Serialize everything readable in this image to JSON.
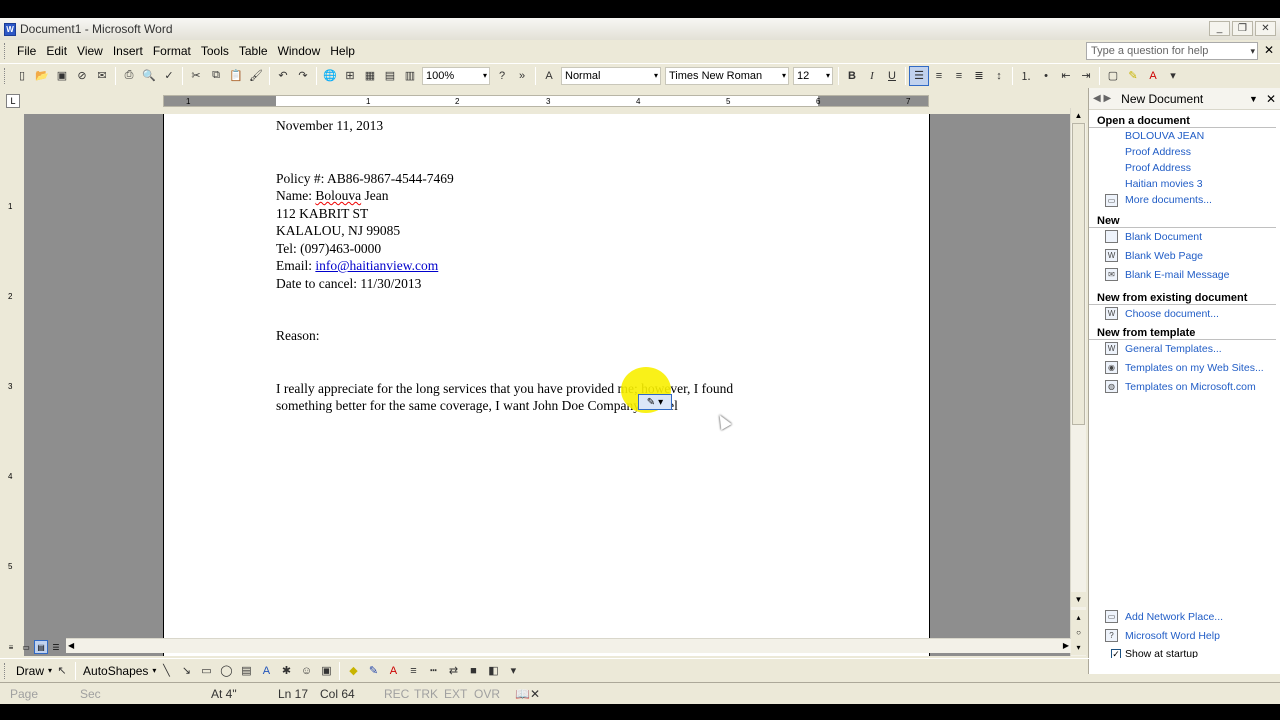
{
  "window": {
    "title": "Document1 - Microsoft Word",
    "app_icon": "W"
  },
  "menu": {
    "items": [
      "File",
      "Edit",
      "View",
      "Insert",
      "Format",
      "Tools",
      "Table",
      "Window",
      "Help"
    ],
    "help_placeholder": "Type a question for help"
  },
  "toolbar": {
    "zoom": "100%",
    "style": "Normal",
    "font": "Times New Roman",
    "size": "12",
    "bold": "B",
    "italic": "I",
    "underline": "U"
  },
  "ruler": {
    "numbers": [
      "1",
      "1",
      "2",
      "3",
      "4",
      "5",
      "6",
      "7"
    ]
  },
  "vruler": {
    "numbers": [
      "1",
      "2",
      "3",
      "4",
      "5"
    ]
  },
  "document": {
    "date": "November 11, 2013",
    "policy": "Policy #: AB86-9867-4544-7469",
    "name_label": "Name: ",
    "name_value": "Bolouva",
    "name_rest": " Jean",
    "address1": "112 KABRIT ST",
    "address2": "KALALOU, NJ 99085",
    "tel": "Tel: (097)463-0000",
    "email_label": "Email: ",
    "email_value": "info@haitianview.com",
    "cancel_date": "Date to cancel: 11/30/2013",
    "reason": "Reason:",
    "para_line1": "I really appreciate for the long services that you have provided me; however, I found",
    "para_line2": "something better for the same coverage, I want John Doe Company cancel"
  },
  "taskpane": {
    "title": "New Document",
    "open_section": "Open a document",
    "recent": [
      "BOLOUVA JEAN",
      "Proof Address",
      "Proof Address",
      "Haitian movies 3"
    ],
    "more_docs": "More documents...",
    "new_section": "New",
    "new_items": [
      "Blank Document",
      "Blank Web Page",
      "Blank E-mail Message"
    ],
    "existing_section": "New from existing document",
    "choose_doc": "Choose document...",
    "template_section": "New from template",
    "template_items": [
      "General Templates...",
      "Templates on my Web Sites...",
      "Templates on Microsoft.com"
    ],
    "add_network": "Add Network Place...",
    "word_help": "Microsoft Word Help",
    "show_startup": "Show at startup"
  },
  "drawbar": {
    "draw": "Draw",
    "autoshapes": "AutoShapes"
  },
  "status": {
    "page": "Page",
    "sec": "Sec",
    "at": "At 4\"",
    "ln": "Ln 17",
    "col": "Col 64",
    "rec": "REC",
    "trk": "TRK",
    "ext": "EXT",
    "ovr": "OVR"
  }
}
